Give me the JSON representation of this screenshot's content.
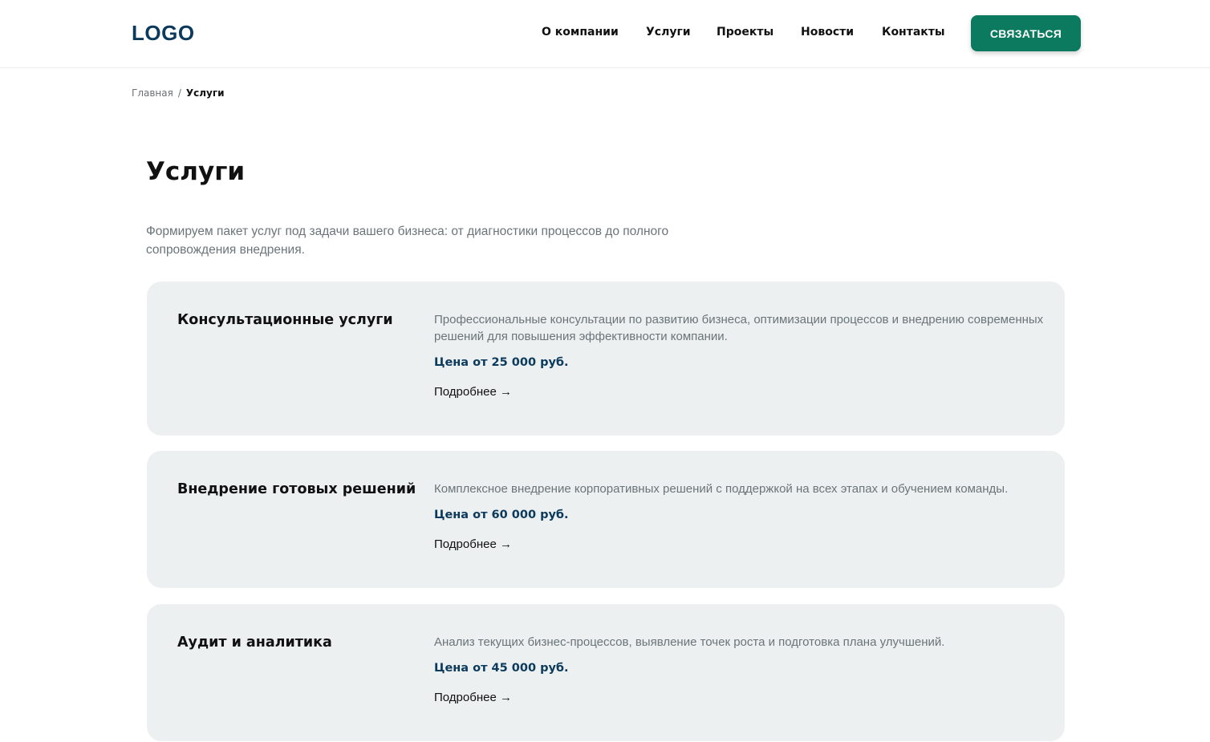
{
  "header": {
    "logo": "LOGO",
    "nav": [
      {
        "label": "О компании"
      },
      {
        "label": "Услуги"
      },
      {
        "label": "Проекты"
      },
      {
        "label": "Новости"
      },
      {
        "label": "Контакты"
      }
    ],
    "cta_label": "СВЯЗАТЬСЯ"
  },
  "breadcrumb": {
    "home": "Главная",
    "separator": "/",
    "current": "Услуги"
  },
  "main": {
    "title": "Услуги",
    "intro": "Формируем пакет услуг под задачи вашего бизнеса: от диагностики процессов до полного сопровождения внедрения."
  },
  "services": [
    {
      "title": "Консультационные услуги",
      "description": "Профессиональные консультации по развитию бизнеса, оптимизации процессов и внедрению современных решений для повышения эффективности компании.",
      "price": "Цена от 25 000 руб.",
      "more": "Подробнее →"
    },
    {
      "title": "Внедрение готовых решений",
      "description": "Комплексное внедрение корпоративных решений с поддержкой на всех этапах и обучением команды.",
      "price": "Цена от 60 000 руб.",
      "more": "Подробнее →"
    },
    {
      "title": "Аудит и аналитика",
      "description": "Анализ текущих бизнес-процессов, выявление точек роста и подготовка плана улучшений.",
      "price": "Цена от 45 000 руб.",
      "more": "Подробнее →"
    }
  ],
  "colors": {
    "brand_dark": "#0b3a5c",
    "accent_green": "#0b7a5f",
    "card_bg": "#edf0f1"
  }
}
